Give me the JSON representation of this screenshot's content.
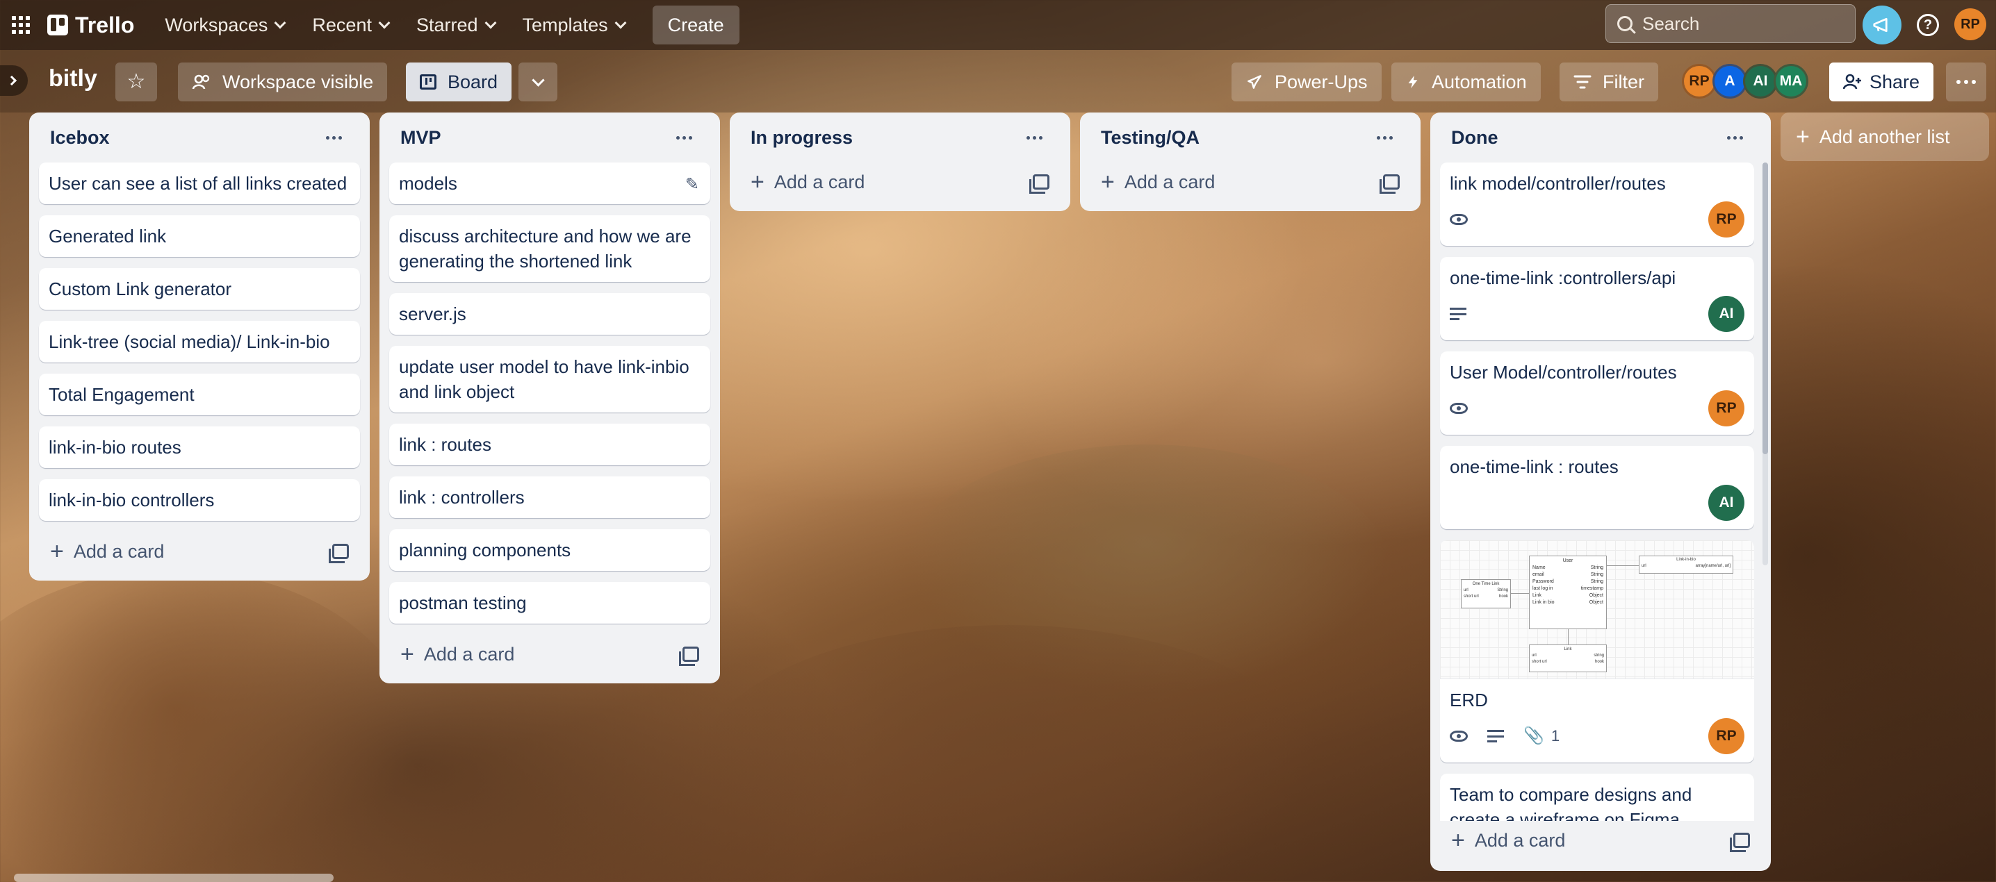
{
  "nav": {
    "brand": "Trello",
    "items": [
      "Workspaces",
      "Recent",
      "Starred",
      "Templates"
    ],
    "create_label": "Create",
    "search_placeholder": "Search",
    "user_initials": "RP",
    "help_glyph": "?"
  },
  "board": {
    "title": "bitly",
    "visibility_label": "Workspace visible",
    "view_label": "Board",
    "powerups_label": "Power-Ups",
    "automation_label": "Automation",
    "filter_label": "Filter",
    "share_label": "Share",
    "members": [
      "RP",
      "A",
      "AI",
      "MA"
    ]
  },
  "lists": [
    {
      "title": "Icebox",
      "cards": [
        "User can see a list of all links created",
        "Generated link",
        "Custom Link generator",
        "Link-tree (social media)/ Link-in-bio",
        "Total Engagement",
        "link-in-bio routes",
        "link-in-bio controllers"
      ],
      "add_label": "Add a card"
    },
    {
      "title": "MVP",
      "cards": [
        "models",
        "discuss architecture and how we are generating the shortened link",
        "server.js",
        "update user model to have link-inbio and link object",
        "link : routes",
        "link : controllers",
        "planning components",
        "postman testing"
      ],
      "add_label": "Add a card"
    },
    {
      "title": "In progress",
      "cards": [],
      "add_label": "Add a card"
    },
    {
      "title": "Testing/QA",
      "cards": [],
      "add_label": "Add a card"
    },
    {
      "title": "Done",
      "cards": [
        {
          "title": "link model/controller/routes",
          "badges": [
            "eye-icon"
          ],
          "member": "RP"
        },
        {
          "title": "one-time-link :controllers/api",
          "badges": [
            "description-icon"
          ],
          "member": "AI"
        },
        {
          "title": "User Model/controller/routes",
          "badges": [
            "eye-icon"
          ],
          "member": "RP"
        },
        {
          "title": "one-time-link : routes",
          "badges": [],
          "member": "AI"
        },
        {
          "title": "ERD",
          "badges": [
            "eye-icon",
            "description-icon",
            "attachment-icon"
          ],
          "attachments": "1",
          "member": "RP"
        },
        {
          "title": "Team to compare designs and create a wireframe on Figma",
          "badges": [],
          "member": ""
        }
      ],
      "add_label": "Add a card"
    }
  ],
  "add_list_label": "Add another list",
  "erd_cover": {
    "tables": [
      {
        "title": "User",
        "rows": [
          "Name",
          "email",
          "Password",
          "last log in",
          "Link",
          "Link in bio"
        ],
        "types": [
          "String",
          "String",
          "String",
          "timestamp",
          "Object",
          "Object"
        ]
      },
      {
        "title": "One Time Link",
        "rows": [
          "url",
          "short url"
        ],
        "types": [
          "String",
          "hook"
        ]
      },
      {
        "title": "Link-in-bio",
        "rows": [
          "url"
        ],
        "types": [
          "array[name/url, url]"
        ]
      },
      {
        "title": "Link",
        "rows": [
          "url",
          "short url"
        ],
        "types": [
          "string",
          "hook"
        ]
      }
    ]
  },
  "colors": {
    "accent_orange": "#e8852a",
    "member_green": "#216e4e",
    "member_blue": "#0c66e4",
    "list_bg": "#f1f2f4"
  }
}
